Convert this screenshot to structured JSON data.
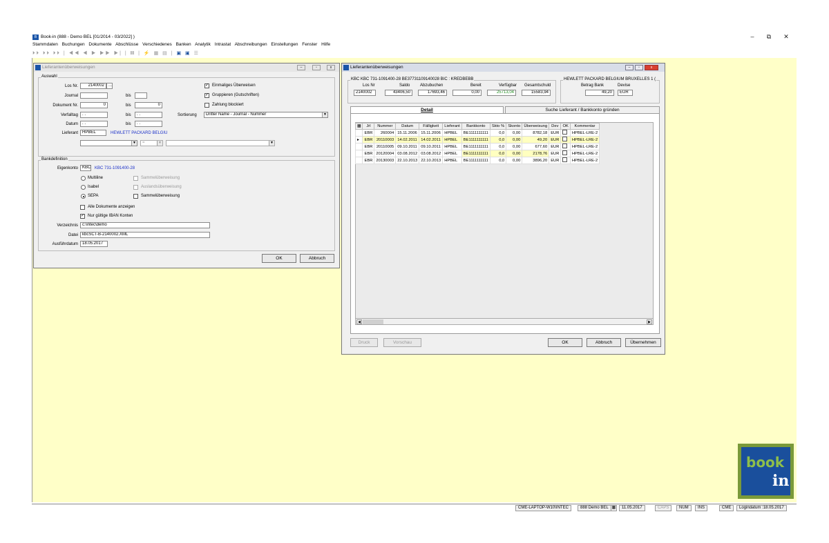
{
  "app": {
    "title": "Book-in (888 - Demo BEL [01/2014 - 03/2022] )",
    "icon": "app-icon",
    "controls": {
      "minimize": "–",
      "restore": "⧉",
      "close": "✕"
    }
  },
  "menu": [
    "Stammdaten",
    "Buchungen",
    "Dokumente",
    "Abschlüsse",
    "Verschiedenes",
    "Banken",
    "Analytik",
    "Intrastat",
    "Abschreibungen",
    "Einstellungen",
    "Fenster",
    "Hilfe"
  ],
  "toolbar": {
    "nav": "⏵⏵ ⏵⏵ ⏵⏵ | ◀◀ ◀ ▶ ▶▶ ▶| | ▤ | ⚡ ▦ ▤ |",
    "extra": "☰"
  },
  "left_window": {
    "title": "Lieferantenüberweisungen",
    "auswahl": {
      "legend": "Auswahl",
      "los_nr_label": "Los Nr.",
      "los_nr_value": "2140002",
      "los_nr_btn": "...",
      "journal_label": "Journal",
      "bis": "bis",
      "dokument_label": "Dokument Nr.",
      "dokument_from": "0",
      "dokument_to": "0",
      "verfalltag_label": "Verfalltag",
      "verfalltag_from": ". .",
      "verfalltag_to": ". .",
      "datum_label": "Datum",
      "datum_from": ". .",
      "datum_to": ". .",
      "lieferant_label": "Lieferant",
      "lieferant_code": "HPBEL",
      "lieferant_name": "HEWLETT PACKARD BELGIU",
      "eq_value": "=",
      "einmaliges": "Einmaliges Überweisen",
      "gruppieren": "Gruppieren (Gutschriften)",
      "zahlung": "Zahlung blockiert",
      "sortierung_label": "Sortierung",
      "sortierung_value": "Dritter Name - Journal - Nummer"
    },
    "bank": {
      "legend": "Bankdefinition",
      "eigenkonto_label": "Eigenkonto",
      "eigenkonto_code": "KBC",
      "eigenkonto_name": "KBC 731-1091400-28",
      "multiline": "Multiline",
      "isabel": "Isabel",
      "sepa": "SEPA",
      "sammel1": "Sammelüberweisung",
      "ausland": "Auslandsüberweisung",
      "sammel2": "Sammelüberweisung",
      "alle_docs": "Alle Dokumente anzeigen",
      "nur_iban": "Nur gültige IBAN Konten",
      "verzeichnis_label": "Verzeichnis",
      "verzeichnis_value": "c:\\intec\\demo",
      "datei_label": "Datei",
      "datei_value": "kbcSCT-B-2140002.XML",
      "ausfuhr_label": "Ausführdatum",
      "ausfuhr_value": "18.05.2017"
    },
    "ok": "OK",
    "abbruch": "Abbruch"
  },
  "right_window": {
    "title": "Lieferantenüberweisungen",
    "header_left": "KBC KBC 731-1091400-28 BE37731109140028 BIC : KREDBEBB",
    "header_right": "HEWLETT PACKARD BELGIUM BRUXELLES 1 (",
    "cols": {
      "los": "Los Nr",
      "saldo": "Saldo",
      "abzu": "Abzubuchen",
      "bereit": "Bereit",
      "verf": "Verfügbar",
      "gesamt": "Gesamtschuld",
      "betrag": "Betrag Bank",
      "devise": "Devise"
    },
    "vals": {
      "los": "2140002",
      "saldo": "43406,50",
      "abzu": "17693,46",
      "bereit": "0,00",
      "verf": "25713,04",
      "gesamt": "15583,94",
      "betrag": "49,20",
      "devise": "EUR"
    },
    "tab_detail": "Detail",
    "tab_suche": "Suche Lieferant / Bankkonto gründen",
    "grid_headers": [
      "Jrl",
      "Nummer",
      "Datum",
      "Fälligkeit",
      "Lieferant",
      "Bankkonto",
      "Skto %",
      "Skonto",
      "Überweisung",
      "Dev",
      "OK",
      "Kommentar"
    ],
    "rows": [
      [
        "EBR",
        "260004",
        "15.11.2006",
        "15.11.2006",
        "HPBEL",
        "BE1111111111",
        "0,0",
        "0,00",
        "8782,18",
        "EUR",
        "",
        "HPBEL-LRE-2"
      ],
      [
        "EBR",
        "20110003",
        "14.02.2011",
        "14.02.2011",
        "HPBEL",
        "BE1111111111",
        "0,0",
        "0,00",
        "49,20",
        "EUR",
        "",
        "HPBEL-LRE-2"
      ],
      [
        "EBR",
        "20110005",
        "09.10.2011",
        "09.10.2011",
        "HPBEL",
        "BE1111111111",
        "0,0",
        "0,00",
        "677,60",
        "EUR",
        "",
        "HPBEL-LRE-2"
      ],
      [
        "EBR",
        "20120004",
        "03.08.2012",
        "03.08.2012",
        "HPBEL",
        "BE1111111111",
        "0,0",
        "0,00",
        "2178,76",
        "EUR",
        "",
        "HPBEL-LRE-2"
      ],
      [
        "EBR",
        "20130003",
        "22.10.2013",
        "22.10.2013",
        "HPBEL",
        "BE1111111111",
        "0,0",
        "0,00",
        "3896,20",
        "EUR",
        "",
        "HPBEL-LRE-2"
      ]
    ],
    "druck": "Druck",
    "vorschau": "Vorschau",
    "ok": "OK",
    "abbruch": "Abbruch",
    "uebernehmen": "Übernehmen"
  },
  "status": {
    "machine": "CME-LAPTOP-W10\\INTEC",
    "company": "888 Demo BEL",
    "date": "11.05.2017",
    "caps": "CAPS",
    "num": "NUM",
    "ins": "INS",
    "user": "CME",
    "login": "Logindatum :18.05.2017"
  },
  "logo": {
    "text": "book",
    "mark": "in"
  }
}
